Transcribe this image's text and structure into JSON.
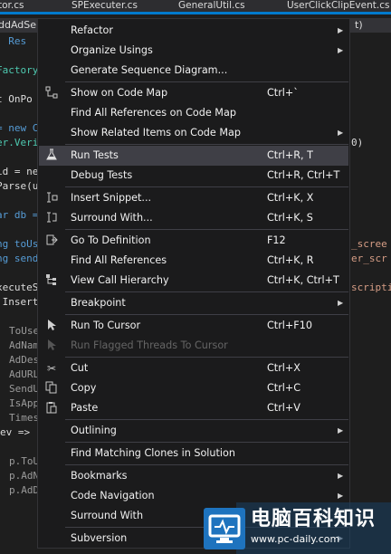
{
  "tabs": [
    "tor.cs",
    "SPExecuter.cs",
    "GeneralUtil.cs",
    "UserClickClipEvent.cs"
  ],
  "editor": {
    "header_fragment": "ddAdSe",
    "header_right": "t)",
    "lines": {
      "l1": ": Res",
      "l2": "Factory",
      "l3": "t OnPo",
      "l4": "= new C",
      "l5": "er.Veri",
      "l6": "id = ne",
      "l7": "Parse(u",
      "l8": "ar db =",
      "l9": "ng toUs",
      "l10": "ng send",
      "l11": "xecuteS",
      "l12": ".Insert",
      "l13": "ToUse",
      "l14": "AdNam",
      "l15": "AdDes",
      "l16": "AdURL",
      "l17": "SendU",
      "l18": "IsApp",
      "l19": "Times",
      "l20": "ev =>",
      "l21": "p.ToU",
      "l22": "p.AdN",
      "l23": "p.AdD",
      "r1": "0)",
      "r2": "_scree",
      "r3": "er_scr",
      "r4": "scripti"
    }
  },
  "menu": {
    "items": [
      {
        "label": "Refactor",
        "shortcut": "",
        "submenu": true,
        "icon": ""
      },
      {
        "label": "Organize Usings",
        "shortcut": "",
        "submenu": true,
        "icon": ""
      },
      {
        "label": "Generate Sequence Diagram...",
        "shortcut": "",
        "submenu": false,
        "icon": ""
      },
      {
        "label": "Show on Code Map",
        "shortcut": "Ctrl+`",
        "submenu": false,
        "icon": "code-map-icon"
      },
      {
        "label": "Find All References on Code Map",
        "shortcut": "",
        "submenu": false,
        "icon": ""
      },
      {
        "label": "Show Related Items on Code Map",
        "shortcut": "",
        "submenu": true,
        "icon": ""
      },
      {
        "label": "Run Tests",
        "shortcut": "Ctrl+R, T",
        "submenu": false,
        "icon": "flask-icon"
      },
      {
        "label": "Debug Tests",
        "shortcut": "Ctrl+R, Ctrl+T",
        "submenu": false,
        "icon": ""
      },
      {
        "label": "Insert Snippet...",
        "shortcut": "Ctrl+K, X",
        "submenu": false,
        "icon": "snippet-icon"
      },
      {
        "label": "Surround With...",
        "shortcut": "Ctrl+K, S",
        "submenu": false,
        "icon": "surround-icon"
      },
      {
        "label": "Go To Definition",
        "shortcut": "F12",
        "submenu": false,
        "icon": "goto-icon"
      },
      {
        "label": "Find All References",
        "shortcut": "Ctrl+K, R",
        "submenu": false,
        "icon": ""
      },
      {
        "label": "View Call Hierarchy",
        "shortcut": "Ctrl+K, Ctrl+T",
        "submenu": false,
        "icon": "call-hierarchy-icon"
      },
      {
        "label": "Breakpoint",
        "shortcut": "",
        "submenu": true,
        "icon": ""
      },
      {
        "label": "Run To Cursor",
        "shortcut": "Ctrl+F10",
        "submenu": false,
        "icon": "cursor-icon"
      },
      {
        "label": "Run Flagged Threads To Cursor",
        "shortcut": "",
        "submenu": false,
        "icon": "cursor-icon"
      },
      {
        "label": "Cut",
        "shortcut": "Ctrl+X",
        "submenu": false,
        "icon": "scissors-icon"
      },
      {
        "label": "Copy",
        "shortcut": "Ctrl+C",
        "submenu": false,
        "icon": "copy-icon"
      },
      {
        "label": "Paste",
        "shortcut": "Ctrl+V",
        "submenu": false,
        "icon": "paste-icon"
      },
      {
        "label": "Outlining",
        "shortcut": "",
        "submenu": true,
        "icon": ""
      },
      {
        "label": "Find Matching Clones in Solution",
        "shortcut": "",
        "submenu": false,
        "icon": ""
      },
      {
        "label": "Bookmarks",
        "shortcut": "",
        "submenu": true,
        "icon": ""
      },
      {
        "label": "Code Navigation",
        "shortcut": "",
        "submenu": true,
        "icon": ""
      },
      {
        "label": "Surround With",
        "shortcut": "",
        "submenu": true,
        "icon": ""
      },
      {
        "label": "Subversion",
        "shortcut": "",
        "submenu": true,
        "icon": ""
      }
    ]
  },
  "watermark": {
    "title": "电脑百科知识",
    "url": "www.pc-daily.com"
  },
  "colors": {
    "accent": "#007acc",
    "menu_bg": "#1b1b1c",
    "highlight": "#3f3f46"
  }
}
